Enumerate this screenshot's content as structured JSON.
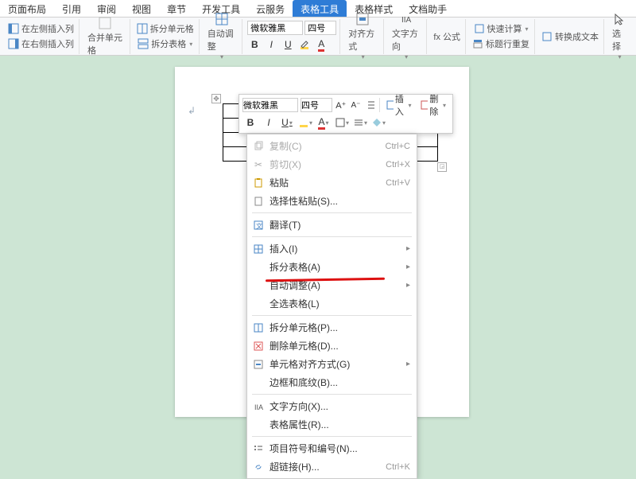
{
  "tabs": [
    "页面布局",
    "引用",
    "审阅",
    "视图",
    "章节",
    "开发工具",
    "云服务",
    "表格工具",
    "表格样式",
    "文档助手"
  ],
  "activeTab": 7,
  "ribbon": {
    "insLeft": "在左侧插入列",
    "insRight": "在右侧插入列",
    "merge": "合并单元格",
    "splitCell": "拆分单元格",
    "splitTable": "拆分表格",
    "autoFit": "自动调整",
    "font": "微软雅黑",
    "size": "四号",
    "align": "对齐方式",
    "textDir": "文字方向",
    "fx": "fx 公式",
    "quickCalc": "快速计算",
    "repeatHeader": "标题行重复",
    "toText": "转换成文本",
    "select": "选择"
  },
  "mini": {
    "font": "微软雅黑",
    "size": "四号",
    "insert": "插入",
    "delete": "删除"
  },
  "menu": {
    "copy": "复制(C)",
    "copy_sc": "Ctrl+C",
    "cut": "剪切(X)",
    "cut_sc": "Ctrl+X",
    "paste": "粘贴",
    "paste_sc": "Ctrl+V",
    "pasteSpecial": "选择性粘贴(S)...",
    "translate": "翻译(T)",
    "insert": "插入(I)",
    "splitTable": "拆分表格(A)",
    "autoFit": "自动调整(A)",
    "selectTable": "全选表格(L)",
    "splitCells": "拆分单元格(P)...",
    "deleteCells": "删除单元格(D)...",
    "cellAlign": "单元格对齐方式(G)",
    "borders": "边框和底纹(B)...",
    "textDir": "文字方向(X)...",
    "tableProps": "表格属性(R)...",
    "bullets": "项目符号和编号(N)...",
    "hyperlink": "超链接(H)...",
    "hyperlink_sc": "Ctrl+K"
  }
}
